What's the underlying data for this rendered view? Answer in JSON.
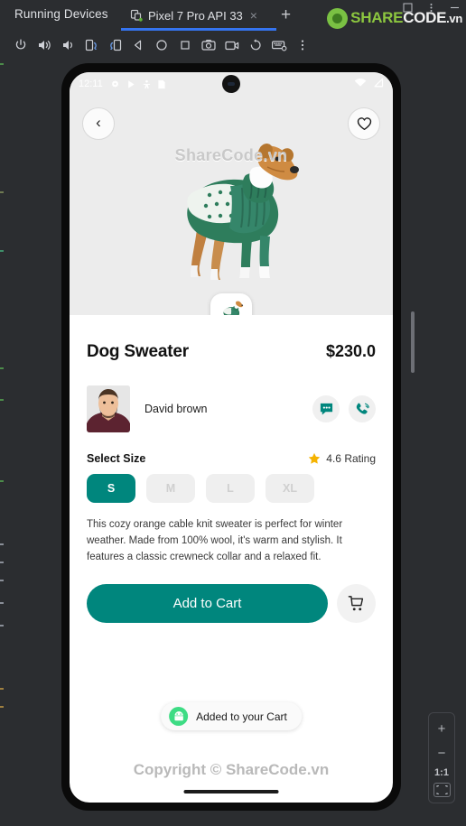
{
  "ide": {
    "tool_window_title": "Running Devices",
    "tab": {
      "label": "Pixel 7 Pro API 33",
      "close": "×",
      "device_icon": "device-icon"
    },
    "add_tab": "+",
    "toolbar_buttons": [
      {
        "name": "power-button",
        "glyph": "power"
      },
      {
        "name": "volume-up-button",
        "glyph": "vol-up"
      },
      {
        "name": "volume-down-button",
        "glyph": "vol-down"
      },
      {
        "name": "rotate-left-button",
        "glyph": "rot-left"
      },
      {
        "name": "rotate-right-button",
        "glyph": "rot-right"
      },
      {
        "name": "back-nav-button",
        "glyph": "back"
      },
      {
        "name": "home-nav-button",
        "glyph": "home"
      },
      {
        "name": "overview-nav-button",
        "glyph": "overview"
      },
      {
        "name": "screenshot-button",
        "glyph": "camera"
      },
      {
        "name": "record-screen-button",
        "glyph": "video"
      },
      {
        "name": "rotate-history-button",
        "glyph": "undo"
      },
      {
        "name": "keyboard-shortcuts-button",
        "glyph": "keyboard"
      },
      {
        "name": "more-options-button",
        "glyph": "kebab"
      }
    ],
    "window_controls": [
      "minimize-restore",
      "more",
      "minimize"
    ],
    "zoom_panel": {
      "zoom_in": "+",
      "zoom_out": "−",
      "actual_size": "1:1",
      "fit_to_screen": "fit-icon"
    },
    "logo": {
      "mark": "sharecode-logo-mark",
      "part1": "SHARE",
      "part2": "CODE",
      "part3": ".vn"
    }
  },
  "phone": {
    "status_bar": {
      "time": "12:11",
      "left_icons": [
        "settings-icon",
        "play-store-icon",
        "location-icon",
        "sim-card-icon"
      ],
      "right_icons": [
        "wifi-icon",
        "cellular-signal-icon"
      ]
    },
    "hero": {
      "back_button": "‹",
      "favorite_button": "heart-outline-icon",
      "watermark": "ShareCode.vn",
      "thumbnail": "product-thumbnail"
    },
    "product": {
      "title": "Dog Sweater",
      "price": "$230.0",
      "seller_name": "David brown",
      "chat_action": "chat-icon",
      "call_action": "phone-call-icon",
      "size_label": "Select Size",
      "rating_text": "4.6 Rating",
      "rating_star": "star-icon",
      "sizes": [
        {
          "label": "S",
          "selected": true
        },
        {
          "label": "M",
          "selected": false
        },
        {
          "label": "L",
          "selected": false
        },
        {
          "label": "XL",
          "selected": false
        }
      ],
      "description": "This cozy orange cable knit sweater is perfect for winter weather. Made from 100% wool, it's warm and stylish. It features a classic crewneck collar and a relaxed fit.",
      "add_to_cart_label": "Add to Cart",
      "cart_button": "shopping-cart-icon"
    },
    "toast": {
      "text": "Added to your Cart",
      "icon": "android-robot-icon"
    },
    "footer_watermark": "Copyright © ShareCode.vn"
  },
  "colors": {
    "accent_teal": "#00867d",
    "tab_underline_blue": "#3574f0",
    "ide_background": "#2b2d30",
    "star_gold": "#f5b301",
    "android_green": "#3ddc84",
    "logo_green": "#8cc63f"
  }
}
